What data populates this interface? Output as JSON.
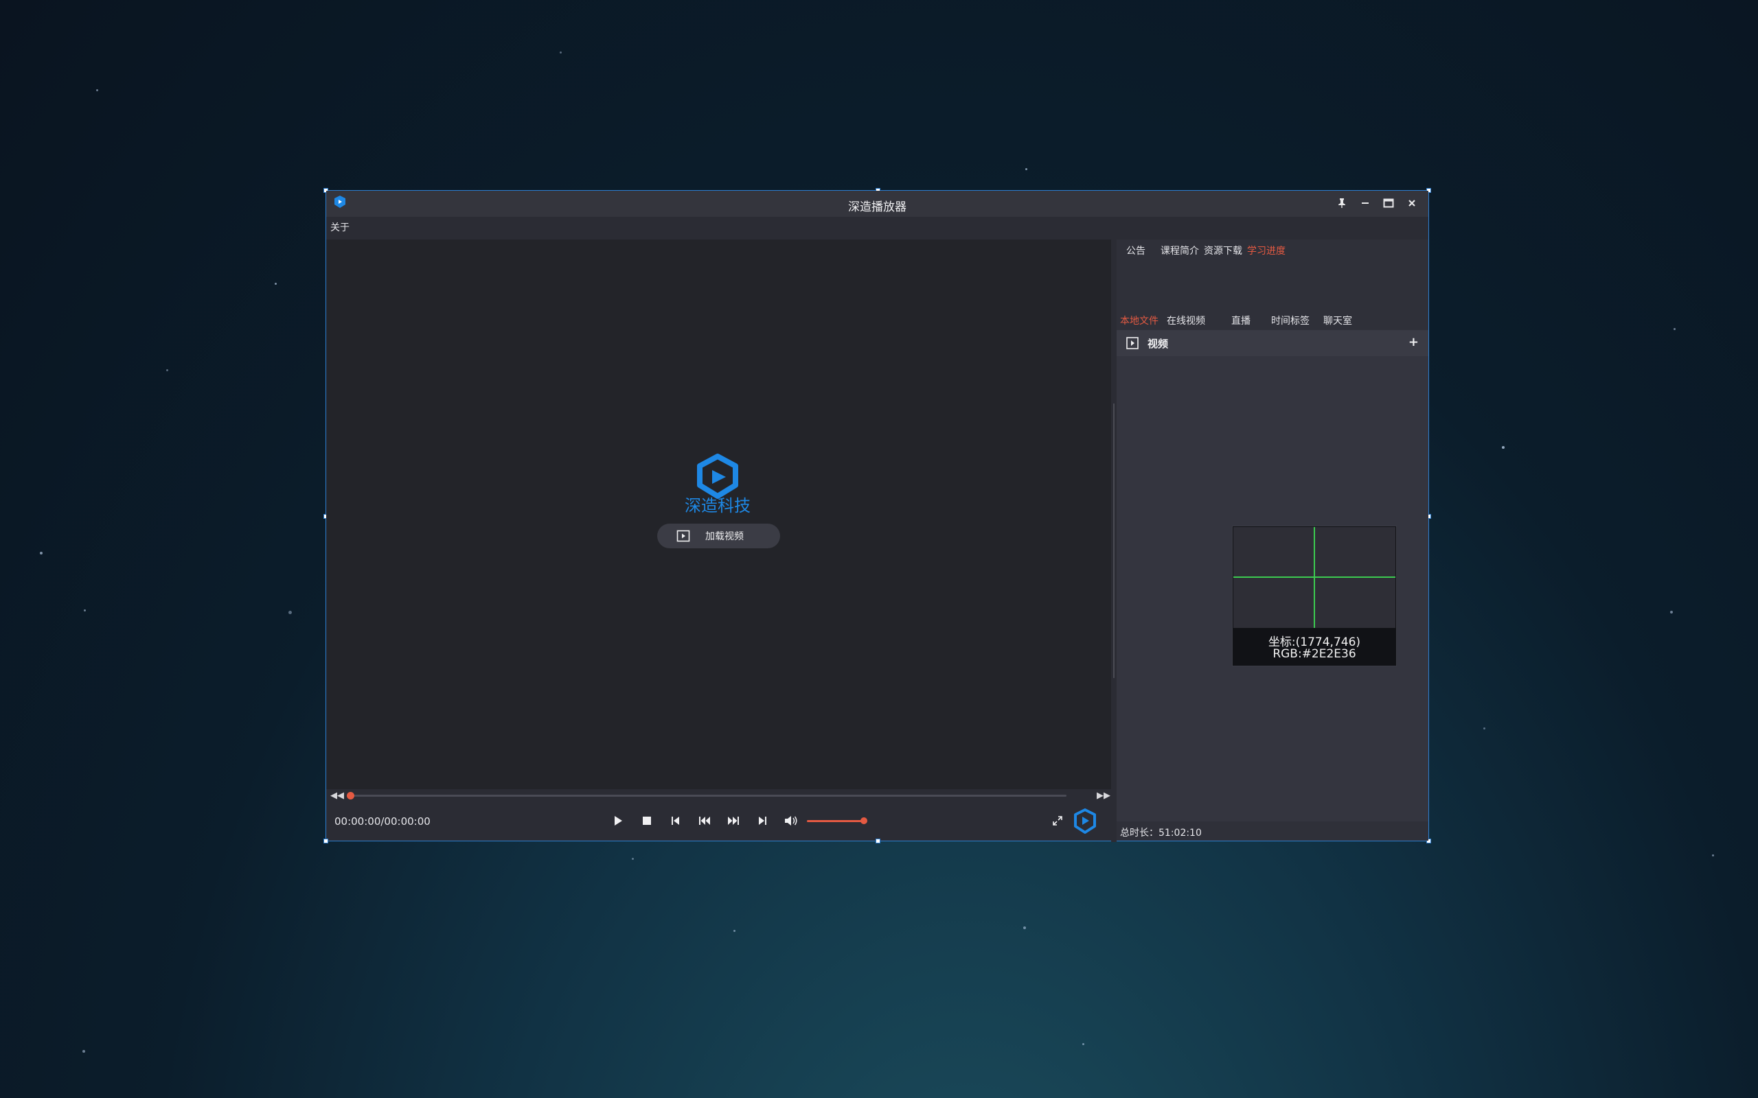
{
  "window": {
    "title": "深造播放器",
    "menu": [
      "关于"
    ],
    "titlebar_icons": [
      "pin-icon",
      "minimize-icon",
      "maximize-icon",
      "close-icon"
    ]
  },
  "player": {
    "load_button": "加载视频",
    "logo_text": "深造科技",
    "time": "00:00:00/00:00:00",
    "progress": 0,
    "volume": 1.0,
    "accent_color": "#E55A42"
  },
  "side_panel": {
    "top_tabs": [
      {
        "label": "公告",
        "active": false
      },
      {
        "label": "课程简介",
        "active": false
      },
      {
        "label": "资源下载",
        "active": false
      },
      {
        "label": "学习进度",
        "active": true
      }
    ],
    "sub_tabs": [
      {
        "label": "本地文件",
        "active": true
      },
      {
        "label": "在线视频",
        "active": false
      },
      {
        "label": "直播",
        "active": false
      },
      {
        "label": "时间标签",
        "active": false
      },
      {
        "label": "聊天室",
        "active": false
      }
    ],
    "section_title": "视频",
    "total_duration": "总时长：51:02:10"
  },
  "color_picker": {
    "coords": "坐标:(1774,746)",
    "rgb": "RGB:#2E2E36",
    "crosshair_color": "#3CCB50"
  }
}
